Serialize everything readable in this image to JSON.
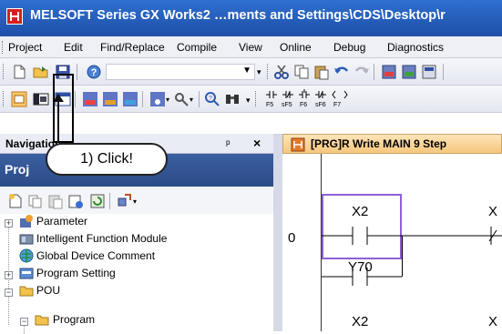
{
  "window": {
    "title": "MELSOFT Series GX Works2 …ments and Settings\\CDS\\Desktop\\r"
  },
  "menu": [
    "Project",
    "Edit",
    "Find/Replace",
    "Compile",
    "View",
    "Online",
    "Debug",
    "Diagnostics"
  ],
  "toolbar": {
    "dropdown_value": ""
  },
  "navigation": {
    "title": "Navigation",
    "pin_glyph": "ᵖ",
    "close_glyph": "×",
    "project_header": "Proj",
    "tree": [
      {
        "label": "Parameter",
        "expander": "+"
      },
      {
        "label": "Intelligent Function Module"
      },
      {
        "label": "Global Device Comment"
      },
      {
        "label": "Program Setting",
        "expander": "+"
      },
      {
        "label": "POU",
        "expander": "−"
      },
      {
        "label": "Program",
        "expander": "−"
      }
    ]
  },
  "callout": {
    "text": "1) Click!"
  },
  "editor": {
    "tab_label": "[PRG]R Write MAIN 9 Step",
    "step_number": "0",
    "contacts": [
      "X2",
      "Y70",
      "X2"
    ],
    "partial_label": "X"
  }
}
